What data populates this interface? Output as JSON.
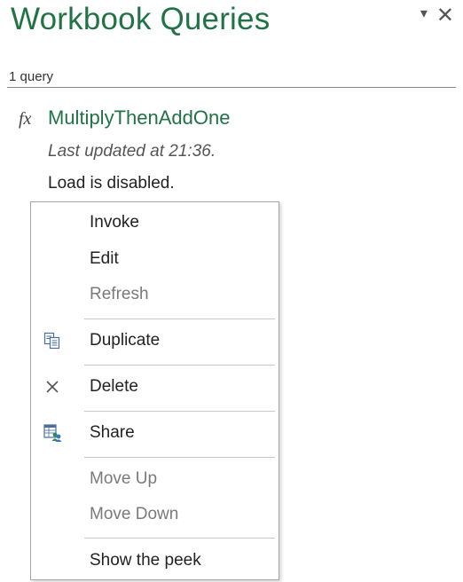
{
  "pane": {
    "title": "Workbook Queries",
    "dropdown_glyph": "▾",
    "close_glyph": "✕",
    "query_count": "1 query"
  },
  "query": {
    "fx_label": "fx",
    "name": "MultiplyThenAddOne",
    "updated": "Last updated at 21:36.",
    "load_status": "Load is disabled."
  },
  "context_menu": {
    "items": [
      {
        "label": "Invoke",
        "enabled": true
      },
      {
        "label": "Edit",
        "enabled": true
      },
      {
        "label": "Refresh",
        "enabled": false
      },
      {
        "label": "Duplicate",
        "enabled": true,
        "icon": "duplicate-icon"
      },
      {
        "label": "Delete",
        "enabled": true,
        "icon": "delete-icon"
      },
      {
        "label": "Share",
        "enabled": true,
        "icon": "share-icon"
      },
      {
        "label": "Move Up",
        "enabled": false
      },
      {
        "label": "Move Down",
        "enabled": false
      },
      {
        "label": "Show the peek",
        "enabled": true
      }
    ]
  },
  "colors": {
    "accent_green": "#217346",
    "disabled_text": "#7a7a7a"
  }
}
